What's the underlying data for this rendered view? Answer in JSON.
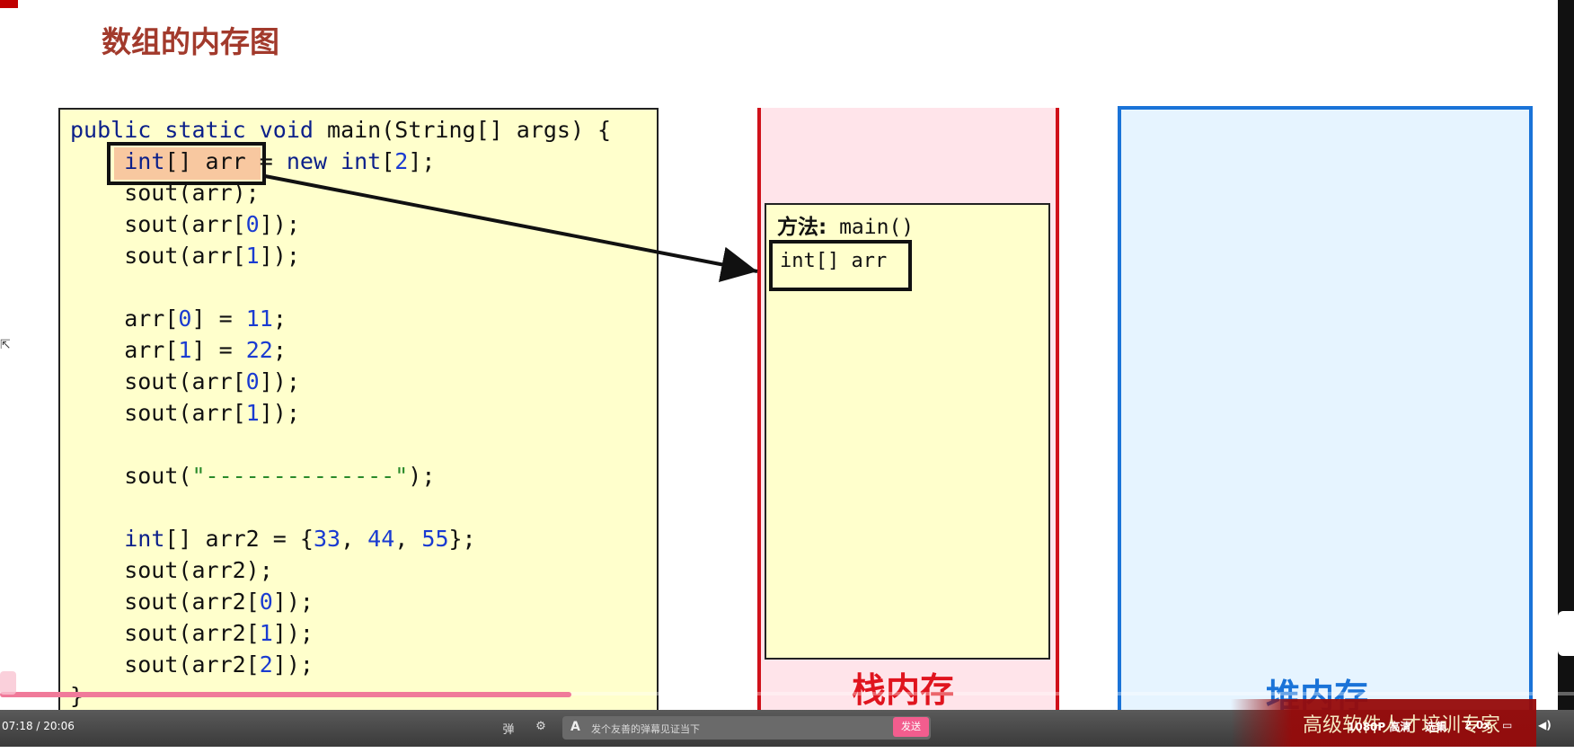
{
  "slide": {
    "title": "数组的内存图",
    "code_lines": [
      "public static void main(String[] args) {",
      "    int[] arr = new int[2];",
      "    sout(arr);",
      "    sout(arr[0]);",
      "    sout(arr[1]);",
      "",
      "    arr[0] = 11;",
      "    arr[1] = 22;",
      "    sout(arr[0]);",
      "    sout(arr[1]);",
      "",
      "    sout(\"--------------\");",
      "",
      "    int[] arr2 = {33, 44, 55};",
      "    sout(arr2);",
      "    sout(arr2[0]);",
      "    sout(arr2[1]);",
      "    sout(arr2[2]);",
      "}"
    ],
    "stack": {
      "method_label_prefix": "方法:",
      "method_name": "main()",
      "variable": "int[] arr",
      "title": "栈内存"
    },
    "heap": {
      "title": "堆内存"
    },
    "colors": {
      "stack_border": "#d0101a",
      "heap_border": "#1a73d8",
      "code_bg": "#ffffcc"
    }
  },
  "player": {
    "time": "07:18 / 20:06",
    "danmaku_placeholder": "发个友善的弹幕见证当下",
    "send_label": "发送",
    "quality": "1080P 高清",
    "episodes": "选集",
    "speed": "2.0x",
    "progress": 0.363,
    "icons": [
      "danmaku-toggle-icon",
      "danmaku-settings-icon",
      "subtitle-icon",
      "volume-icon"
    ]
  },
  "watermark": {
    "text": "高级软件人才培训专家"
  }
}
